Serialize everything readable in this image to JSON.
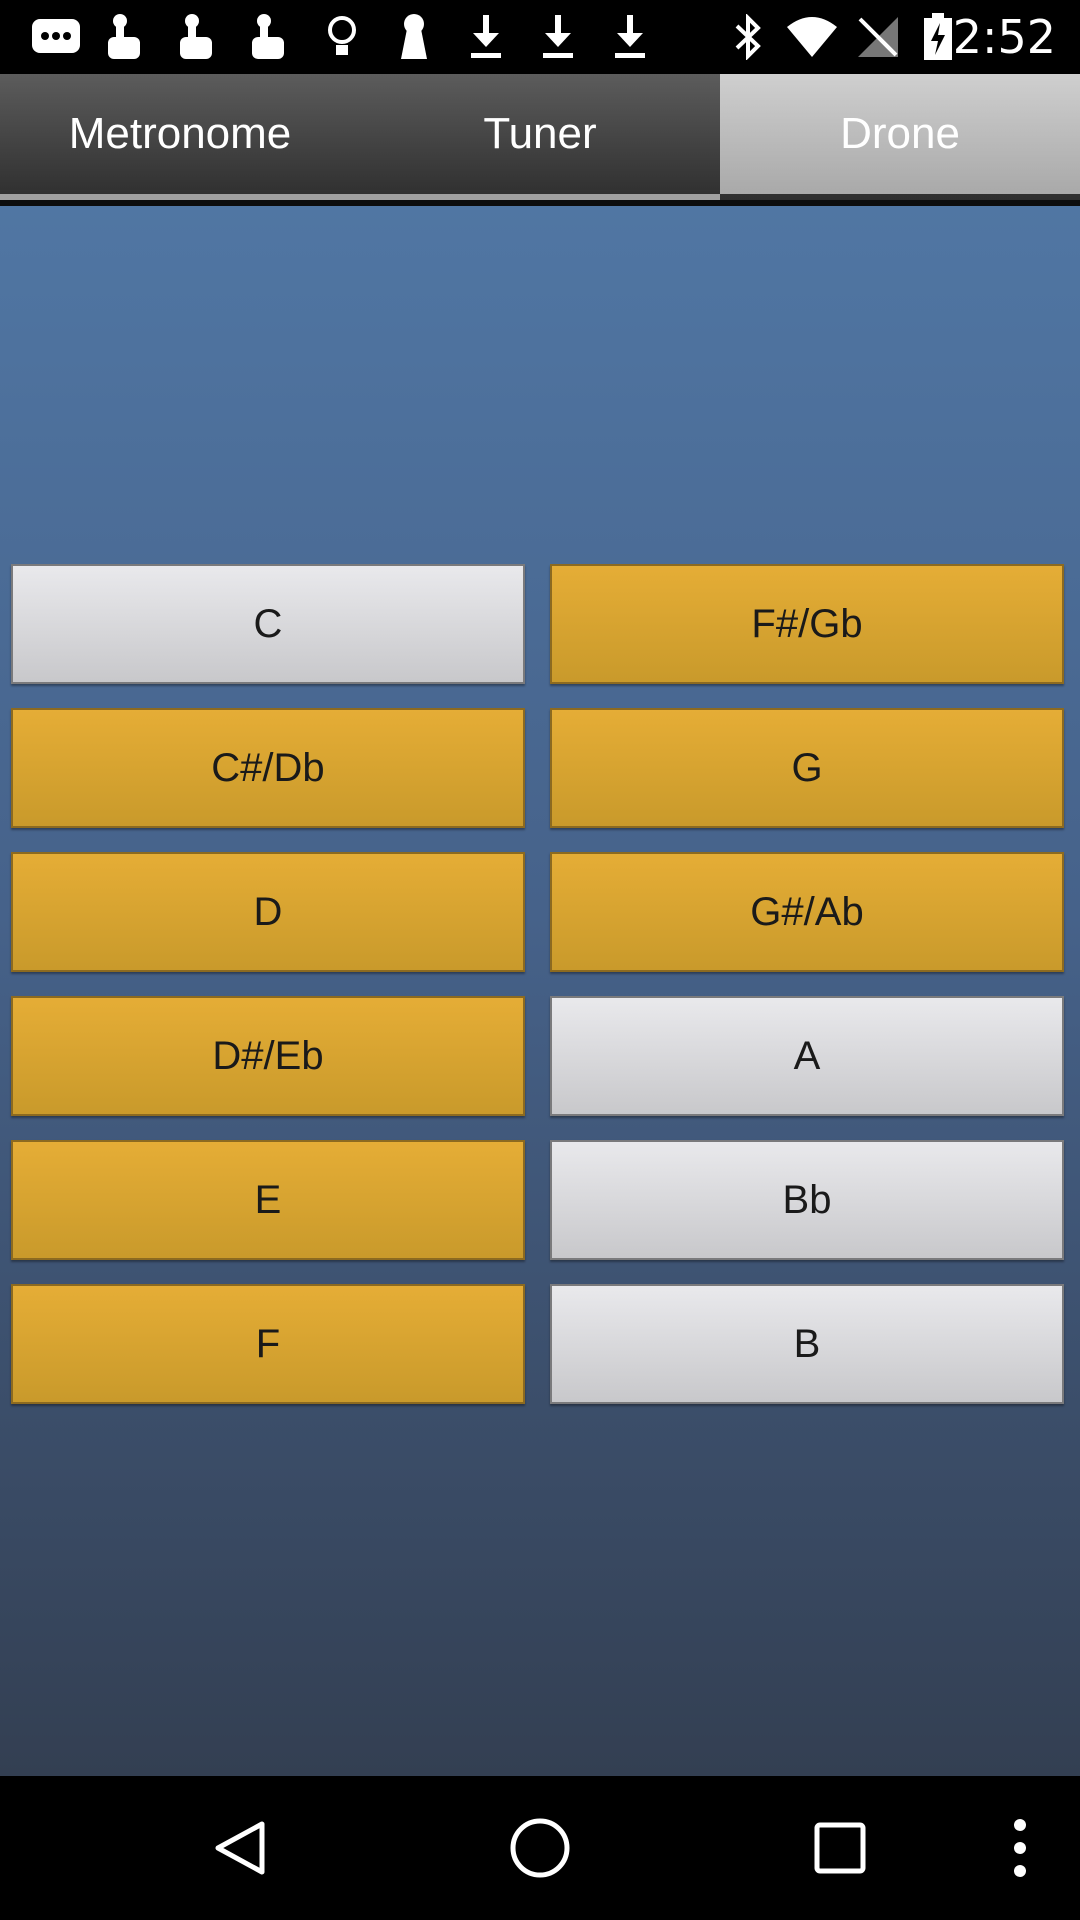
{
  "status_bar": {
    "time": "2:52",
    "icons": [
      "messenger-icon",
      "touch-icon",
      "touch-icon",
      "touch-icon",
      "lightbulb-icon",
      "keyhole-icon",
      "download-icon",
      "download-icon",
      "download-icon",
      "bluetooth-icon",
      "wifi-icon",
      "no-signal-icon",
      "battery-charging-icon"
    ]
  },
  "tabs": [
    {
      "label": "Metronome",
      "selected": false
    },
    {
      "label": "Tuner",
      "selected": false
    },
    {
      "label": "Drone",
      "selected": true
    }
  ],
  "notes": {
    "left": [
      {
        "label": "C",
        "active": false
      },
      {
        "label": "C#/Db",
        "active": true
      },
      {
        "label": "D",
        "active": true
      },
      {
        "label": "D#/Eb",
        "active": true
      },
      {
        "label": "E",
        "active": true
      },
      {
        "label": "F",
        "active": true
      }
    ],
    "right": [
      {
        "label": "F#/Gb",
        "active": true
      },
      {
        "label": "G",
        "active": true
      },
      {
        "label": "G#/Ab",
        "active": true
      },
      {
        "label": "A",
        "active": false
      },
      {
        "label": "Bb",
        "active": false
      },
      {
        "label": "B",
        "active": false
      }
    ]
  },
  "nav_bar": {
    "icons": [
      "back-icon",
      "home-icon",
      "recents-icon",
      "overflow-menu-icon"
    ]
  },
  "colors": {
    "active_button": "#dca733",
    "inactive_button": "#dcdcdf",
    "background_top": "#5076a3",
    "background_bottom": "#333f52",
    "tab_bar": "#3a3a3a",
    "tab_selected": "#bcbcbc"
  }
}
